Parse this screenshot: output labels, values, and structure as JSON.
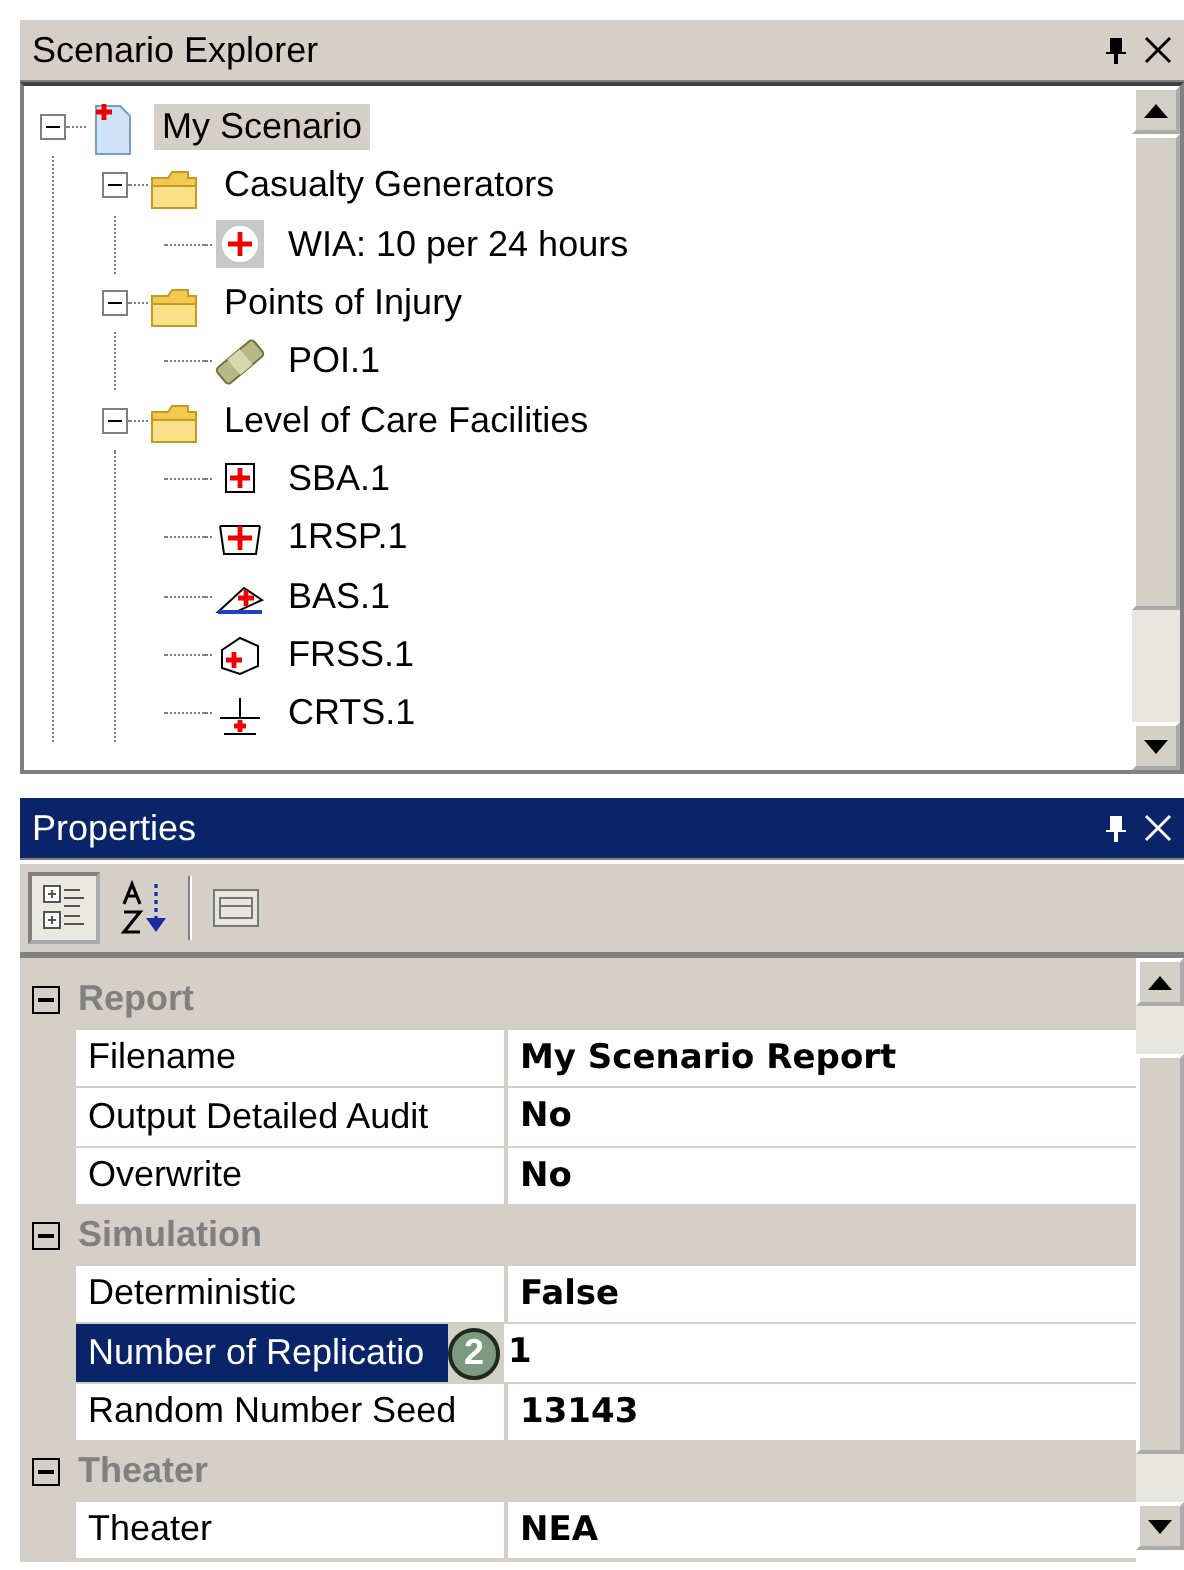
{
  "explorer": {
    "title": "Scenario Explorer",
    "active": false,
    "tree": [
      {
        "label": "My Scenario",
        "kind": "scenario",
        "selected": true,
        "expanded": true,
        "children": [
          {
            "label": "Casualty Generators",
            "kind": "folder",
            "selected": false,
            "expanded": true,
            "children": [
              {
                "label": "WIA: 10 per 24 hours",
                "kind": "casualty",
                "selected": false
              }
            ]
          },
          {
            "label": "Points of Injury",
            "kind": "folder",
            "selected": false,
            "expanded": true,
            "children": [
              {
                "label": "POI.1",
                "kind": "poi",
                "selected": false
              }
            ]
          },
          {
            "label": "Level of Care Facilities",
            "kind": "folder",
            "selected": false,
            "expanded": true,
            "children": [
              {
                "label": "SBA.1",
                "kind": "sba",
                "selected": false
              },
              {
                "label": "1RSP.1",
                "kind": "rsp",
                "selected": false
              },
              {
                "label": "BAS.1",
                "kind": "bas",
                "selected": false
              },
              {
                "label": "FRSS.1",
                "kind": "frss",
                "selected": false
              },
              {
                "label": "CRTS.1",
                "kind": "crts",
                "selected": false
              }
            ]
          }
        ]
      }
    ]
  },
  "properties": {
    "title": "Properties",
    "active": true,
    "tools": [
      {
        "kind": "categorized",
        "selected": true
      },
      {
        "kind": "alphabetical",
        "selected": false
      },
      {
        "kind": "pages",
        "selected": false
      }
    ],
    "categories": [
      {
        "name": "Report",
        "expanded": true,
        "rows": [
          {
            "name": "Filename",
            "value": "My Scenario Report",
            "selected": false
          },
          {
            "name": "Output Detailed Audit",
            "value": "No",
            "selected": false
          },
          {
            "name": "Overwrite",
            "value": "No",
            "selected": false
          }
        ]
      },
      {
        "name": "Simulation",
        "expanded": true,
        "rows": [
          {
            "name": "Deterministic",
            "value": "False",
            "selected": false
          },
          {
            "name": "Number of Replicatio",
            "value": "1",
            "selected": true,
            "callout": "2"
          },
          {
            "name": "Random Number Seed",
            "value": "13143",
            "selected": false
          }
        ]
      },
      {
        "name": "Theater",
        "expanded": true,
        "rows": [
          {
            "name": "Theater",
            "value": "NEA",
            "selected": false
          }
        ]
      }
    ]
  }
}
